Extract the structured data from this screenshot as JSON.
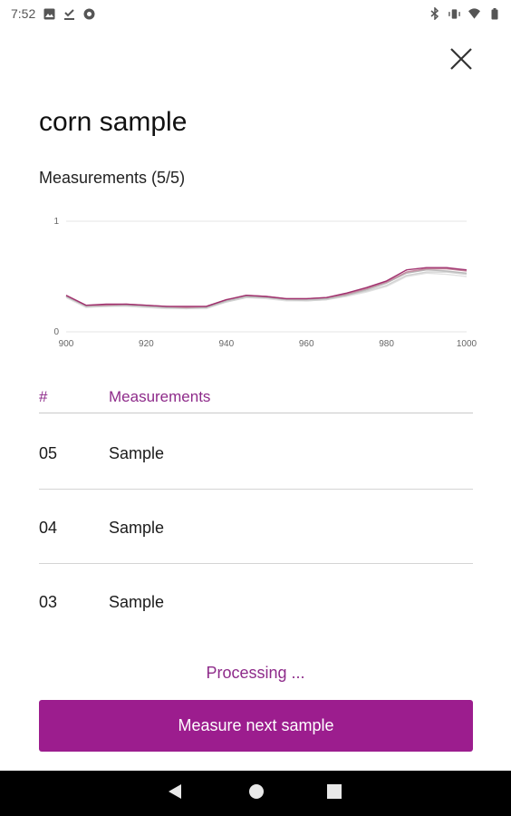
{
  "status_bar": {
    "time": "7:52",
    "left_icons": [
      "image-icon",
      "download-done-icon",
      "sync-icon"
    ],
    "right_icons": [
      "bluetooth-icon",
      "vibrate-icon",
      "wifi-icon",
      "battery-icon"
    ]
  },
  "header": {
    "close_icon": "close-icon",
    "title": "corn sample"
  },
  "measurements": {
    "label": "Measurements (5/5)"
  },
  "chart_data": {
    "type": "line",
    "title": "",
    "xlabel": "",
    "ylabel": "",
    "xlim": [
      900,
      1000
    ],
    "ylim": [
      0,
      1
    ],
    "x_ticks": [
      "900",
      "920",
      "940",
      "960",
      "980",
      "1000"
    ],
    "y_ticks": [
      "0",
      "1"
    ],
    "grid": true,
    "x": [
      900,
      905,
      910,
      915,
      920,
      925,
      930,
      935,
      940,
      945,
      950,
      955,
      960,
      965,
      970,
      975,
      980,
      985,
      990,
      995,
      1000
    ],
    "series": [
      {
        "color": "#a0306e",
        "values": [
          0.33,
          0.24,
          0.25,
          0.25,
          0.24,
          0.23,
          0.23,
          0.23,
          0.29,
          0.33,
          0.32,
          0.3,
          0.3,
          0.31,
          0.35,
          0.4,
          0.46,
          0.56,
          0.58,
          0.58,
          0.56
        ]
      },
      {
        "color": "#c48a9f",
        "values": [
          0.33,
          0.24,
          0.24,
          0.25,
          0.24,
          0.23,
          0.22,
          0.23,
          0.29,
          0.33,
          0.32,
          0.3,
          0.3,
          0.31,
          0.34,
          0.39,
          0.45,
          0.54,
          0.57,
          0.57,
          0.55
        ]
      },
      {
        "color": "#b9b9b9",
        "values": [
          0.32,
          0.23,
          0.24,
          0.24,
          0.23,
          0.22,
          0.22,
          0.22,
          0.28,
          0.32,
          0.31,
          0.29,
          0.29,
          0.3,
          0.33,
          0.38,
          0.44,
          0.53,
          0.56,
          0.55,
          0.53
        ]
      },
      {
        "color": "#d2d2d2",
        "values": [
          0.32,
          0.23,
          0.23,
          0.24,
          0.23,
          0.22,
          0.21,
          0.22,
          0.27,
          0.31,
          0.31,
          0.29,
          0.28,
          0.29,
          0.33,
          0.37,
          0.42,
          0.51,
          0.54,
          0.54,
          0.52
        ]
      },
      {
        "color": "#e2e2e2",
        "values": [
          0.31,
          0.22,
          0.23,
          0.23,
          0.22,
          0.21,
          0.21,
          0.21,
          0.27,
          0.31,
          0.3,
          0.28,
          0.28,
          0.29,
          0.32,
          0.36,
          0.41,
          0.5,
          0.53,
          0.52,
          0.5
        ]
      }
    ]
  },
  "table": {
    "col_num": "#",
    "col_name": "Measurements",
    "rows": [
      {
        "num": "05",
        "name": "Sample"
      },
      {
        "num": "04",
        "name": "Sample"
      },
      {
        "num": "03",
        "name": "Sample"
      }
    ]
  },
  "processing_text": "Processing ...",
  "primary_button_label": "Measure next sample",
  "colors": {
    "accent": "#9c1d8e",
    "accent_text": "#8e2b8a",
    "divider": "#d4d4d4"
  },
  "nav_bar": {
    "icons": [
      "back-icon",
      "home-icon",
      "recents-icon"
    ]
  }
}
